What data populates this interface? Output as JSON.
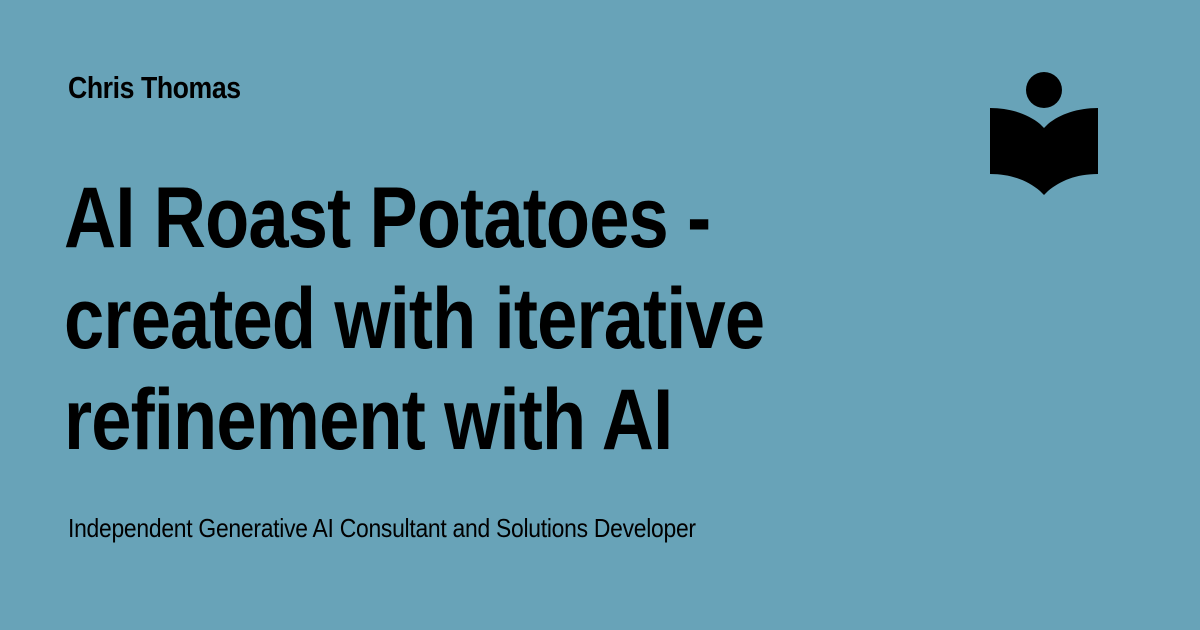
{
  "card": {
    "author": "Chris Thomas",
    "title_lines": [
      "AI Roast Potatoes -",
      "created with iterative",
      "refinement with AI"
    ],
    "subtitle": "Independent Generative AI Consultant and Solutions Developer",
    "logo_icon": "reader-book-icon",
    "background_color": "#68a3b8",
    "text_color": "#000000"
  }
}
